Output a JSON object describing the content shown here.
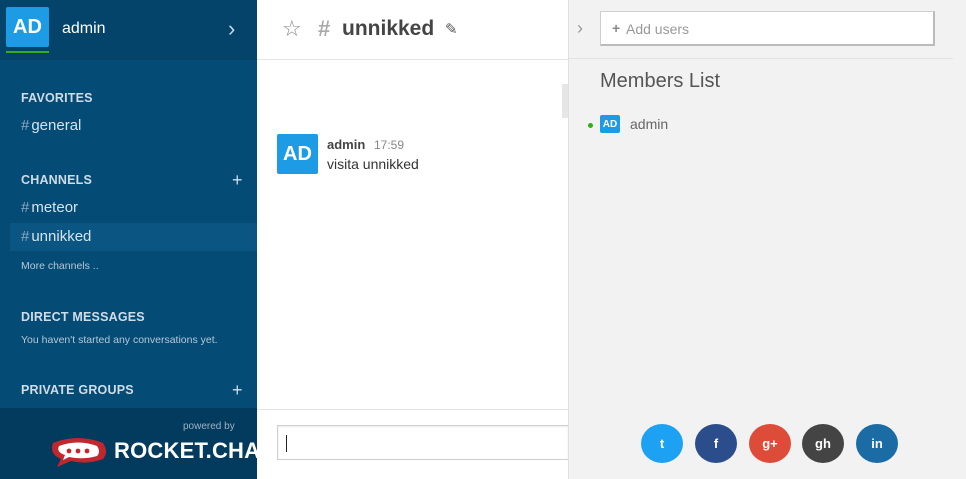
{
  "user": {
    "initials": "AD",
    "name": "admin"
  },
  "sidebar": {
    "favorites_title": "FAVORITES",
    "favorites": [
      {
        "label": "general"
      }
    ],
    "channels_title": "CHANNELS",
    "channels": [
      {
        "label": "meteor"
      },
      {
        "label": "unnikked"
      }
    ],
    "more_channels": "More channels ..",
    "direct_title": "DIRECT MESSAGES",
    "direct_empty": "You haven't started any conversations yet.",
    "private_title": "PRIVATE GROUPS",
    "powered_by": "powered by",
    "brand": "ROCKET.CHAT"
  },
  "room": {
    "hash": "#",
    "name": "unnikked"
  },
  "messages": [
    {
      "initials": "AD",
      "user": "admin",
      "time": "17:59",
      "text": "visita unnikked"
    }
  ],
  "members": {
    "add_placeholder": "Add users",
    "title": "Members List",
    "list": [
      {
        "initials": "AD",
        "name": "admin"
      }
    ]
  },
  "social": [
    {
      "name": "twitter",
      "glyph": "t",
      "color": "#1da1f2"
    },
    {
      "name": "facebook",
      "glyph": "f",
      "color": "#2b4d8c"
    },
    {
      "name": "google-plus",
      "glyph": "g+",
      "color": "#dd4b39"
    },
    {
      "name": "github",
      "glyph": "gh",
      "color": "#444444"
    },
    {
      "name": "linkedin",
      "glyph": "in",
      "color": "#1b6ba5"
    }
  ]
}
